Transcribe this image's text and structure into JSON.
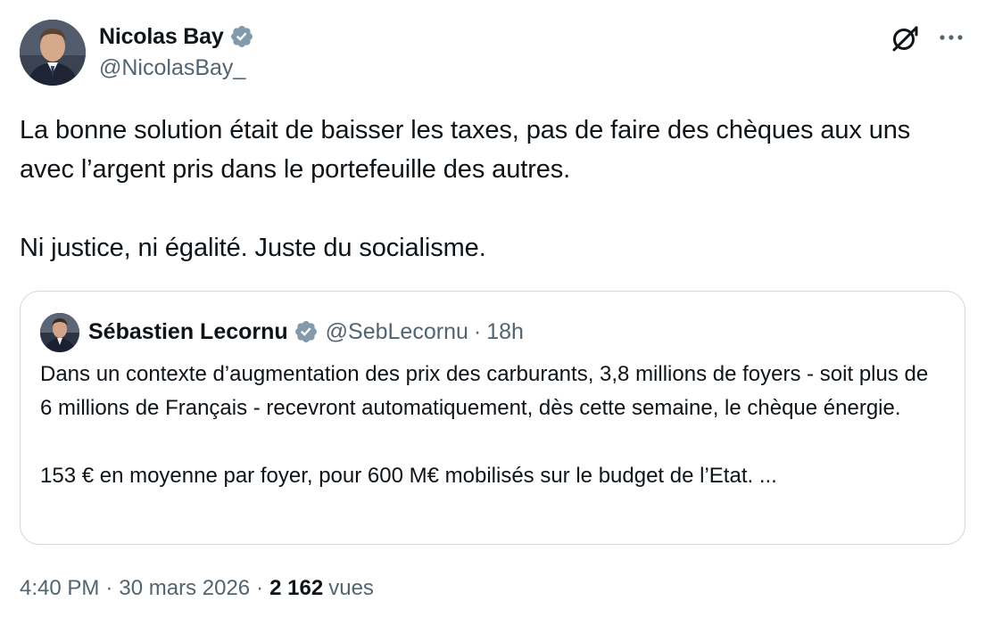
{
  "tweet": {
    "author": {
      "name": "Nicolas Bay",
      "handle": "@NicolasBay_",
      "verified": true
    },
    "text_paragraphs": [
      "La bonne solution était de baisser les taxes, pas de faire des chèques aux uns avec l’argent pris dans le portefeuille des autres.",
      "Ni justice, ni égalité. Juste du socialisme."
    ],
    "quoted": {
      "author_name": "Sébastien Lecornu",
      "handle": "@SebLecornu",
      "separator": "·",
      "time": "18h",
      "verified": true,
      "text_paragraphs": [
        "Dans un contexte d’augmentation des prix des carburants, 3,8 millions de foyers - soit plus de 6 millions de Français - recevront automatiquement, dès cette semaine, le chèque énergie.",
        "153 € en moyenne par foyer, pour 600 M€ mobilisés sur le budget de l’Etat. ..."
      ]
    },
    "meta": {
      "time": "4:40 PM",
      "separator": "·",
      "date": "30 mars 2026",
      "views_count": "2 162",
      "views_label": "vues"
    }
  },
  "icons": {
    "verified": "verified-badge-icon",
    "grok": "grok-icon",
    "more": "more-options-icon"
  },
  "colors": {
    "text_primary": "#0f1419",
    "text_secondary": "#536471",
    "verified_badge": "#829aab",
    "border": "#cfd9de"
  }
}
